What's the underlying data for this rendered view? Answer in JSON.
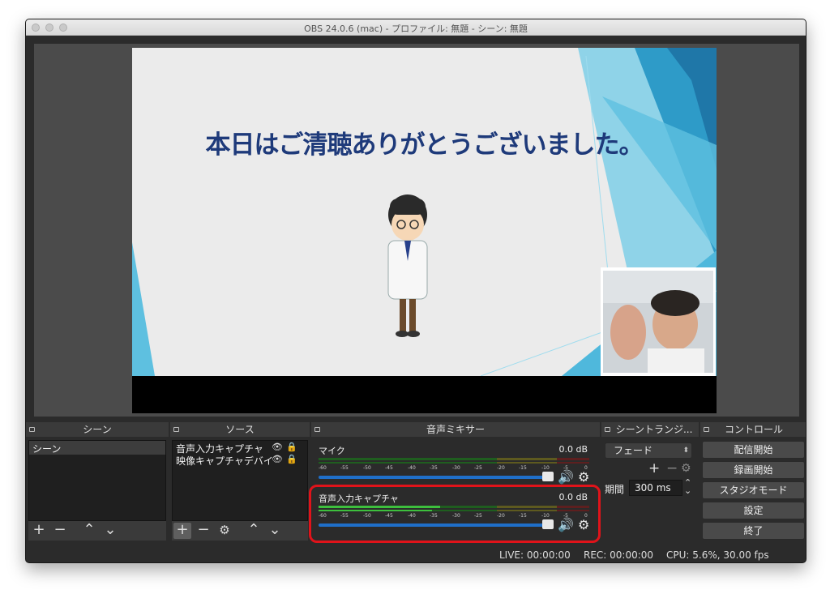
{
  "window": {
    "title": "OBS 24.0.6 (mac) - プロファイル: 無題 - シーン: 無題"
  },
  "preview": {
    "slide_text": "本日はご清聴ありがとうございました。"
  },
  "docks": {
    "scenes": {
      "title": "シーン",
      "items": [
        "シーン"
      ]
    },
    "sources": {
      "title": "ソース",
      "items": [
        "音声入力キャプチャ",
        "映像キャプチャデバイ"
      ]
    },
    "mixer": {
      "title": "音声ミキサー",
      "channels": [
        {
          "name": "マイク",
          "db": "0.0 dB"
        },
        {
          "name": "音声入力キャプチャ",
          "db": "0.0 dB"
        }
      ],
      "scale": [
        "-60",
        "-55",
        "-50",
        "-45",
        "-40",
        "-35",
        "-30",
        "-25",
        "-20",
        "-15",
        "-10",
        "-5",
        "0"
      ]
    },
    "transitions": {
      "title": "シーントランジ...",
      "selected": "フェード",
      "duration_label": "期間",
      "duration_value": "300 ms"
    },
    "controls": {
      "title": "コントロール",
      "buttons": [
        "配信開始",
        "録画開始",
        "スタジオモード",
        "設定",
        "終了"
      ]
    }
  },
  "status": {
    "live": "LIVE: 00:00:00",
    "rec": "REC: 00:00:00",
    "cpu": "CPU: 5.6%, 30.00 fps"
  },
  "colors": {
    "highlight": "#e0131a",
    "slider": "#1f6fc9",
    "title_text": "#1e3a7a"
  }
}
